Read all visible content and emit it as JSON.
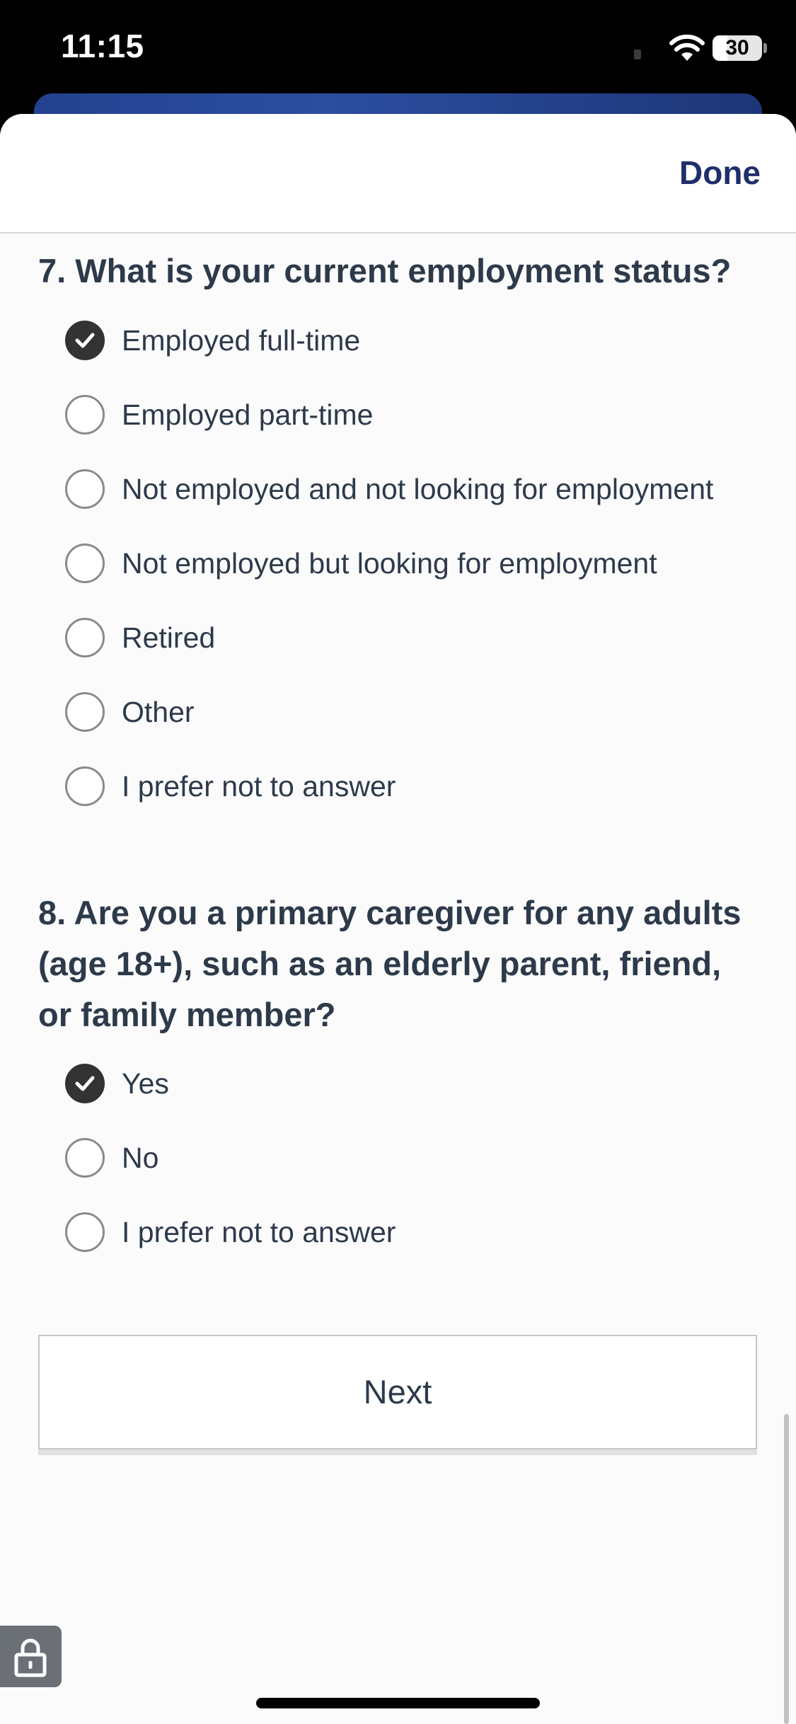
{
  "status_bar": {
    "time": "11:15",
    "battery_level": "30"
  },
  "header": {
    "done_label": "Done"
  },
  "questions": [
    {
      "title": "7. What is your current employment status?",
      "options": [
        {
          "label": "Employed full-time",
          "checked": true
        },
        {
          "label": "Employed part-time",
          "checked": false
        },
        {
          "label": "Not employed and not looking for employment",
          "checked": false
        },
        {
          "label": "Not employed but looking for employment",
          "checked": false
        },
        {
          "label": "Retired",
          "checked": false
        },
        {
          "label": "Other",
          "checked": false
        },
        {
          "label": "I prefer not to answer",
          "checked": false
        }
      ]
    },
    {
      "title": "8. Are you a primary caregiver for any adults (age 18+), such as an elderly parent, friend, or family member?",
      "options": [
        {
          "label": "Yes",
          "checked": true
        },
        {
          "label": "No",
          "checked": false
        },
        {
          "label": "I prefer not to answer",
          "checked": false
        }
      ]
    }
  ],
  "next_label": "Next",
  "icons": {
    "wifi": "wifi-icon",
    "battery": "battery-icon",
    "lock": "lock-icon",
    "check": "checkmark-icon"
  },
  "colors": {
    "accent": "#1f2f6b",
    "text": "#2d3a4a",
    "checked_fill": "#333333",
    "card_blue": "#23418f"
  }
}
